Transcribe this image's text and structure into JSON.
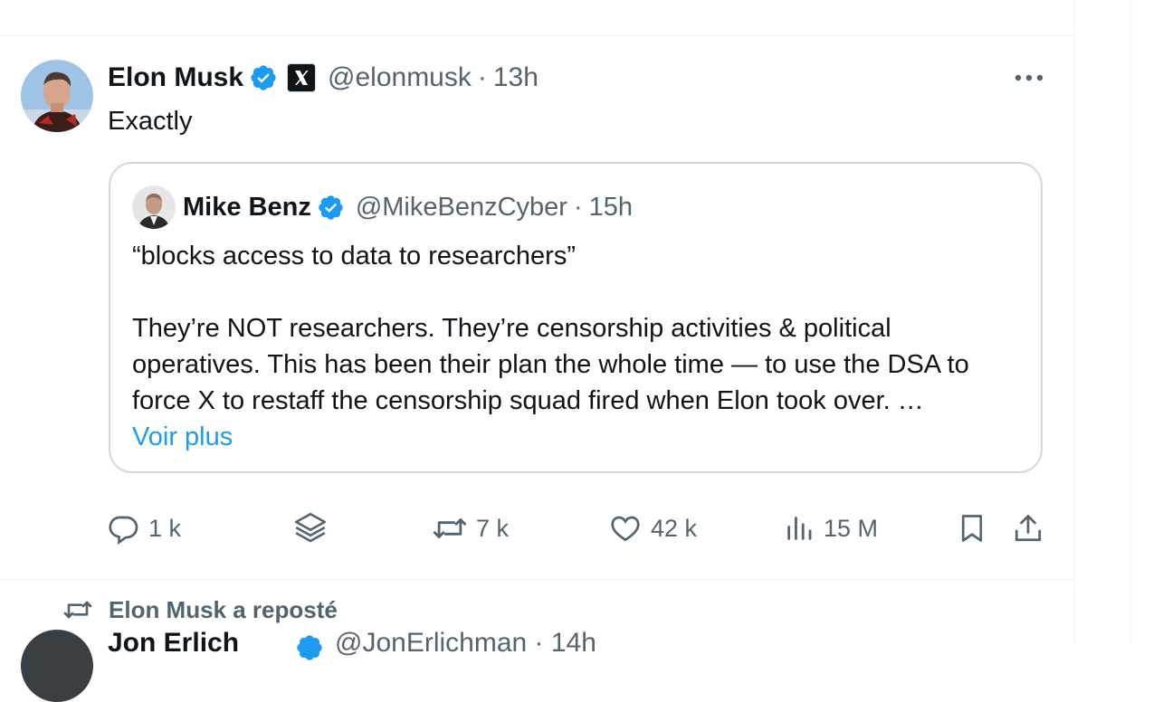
{
  "post": {
    "author_name": "Elon Musk",
    "handle": "@elonmusk",
    "separator": "·",
    "time": "13h",
    "text": "Exactly"
  },
  "quote": {
    "author_name": "Mike Benz",
    "handle": "@MikeBenzCyber",
    "separator": "·",
    "time": "15h",
    "line1": "“blocks access to data to researchers”",
    "line2": "They’re NOT researchers. They’re censorship activities & political",
    "line3": "operatives. This has been their plan the whole time — to use the DSA to",
    "line4": "force X to restaff the censorship squad fired when Elon took over. …",
    "more_link": "Voir plus"
  },
  "actions": {
    "replies": "1 k",
    "reposts": "7 k",
    "likes": "42 k",
    "views": "15 M"
  },
  "next": {
    "repost_label": "Elon Musk a reposté",
    "author_name_partial": "Jon Erlich",
    "handle_partial": "@JonErlichman · 14h"
  },
  "icons": {
    "verified": "verified-badge-icon",
    "x_logo": "x-logo-icon",
    "more": "more-icon",
    "reply": "reply-icon",
    "grok": "grok-icon",
    "repost": "repost-icon",
    "like": "heart-icon",
    "views": "views-icon",
    "bookmark": "bookmark-icon",
    "share": "share-icon"
  },
  "colors": {
    "accent": "#1d9bf0",
    "text": "#0f1419",
    "muted": "#536471",
    "border": "#cfd9de"
  }
}
